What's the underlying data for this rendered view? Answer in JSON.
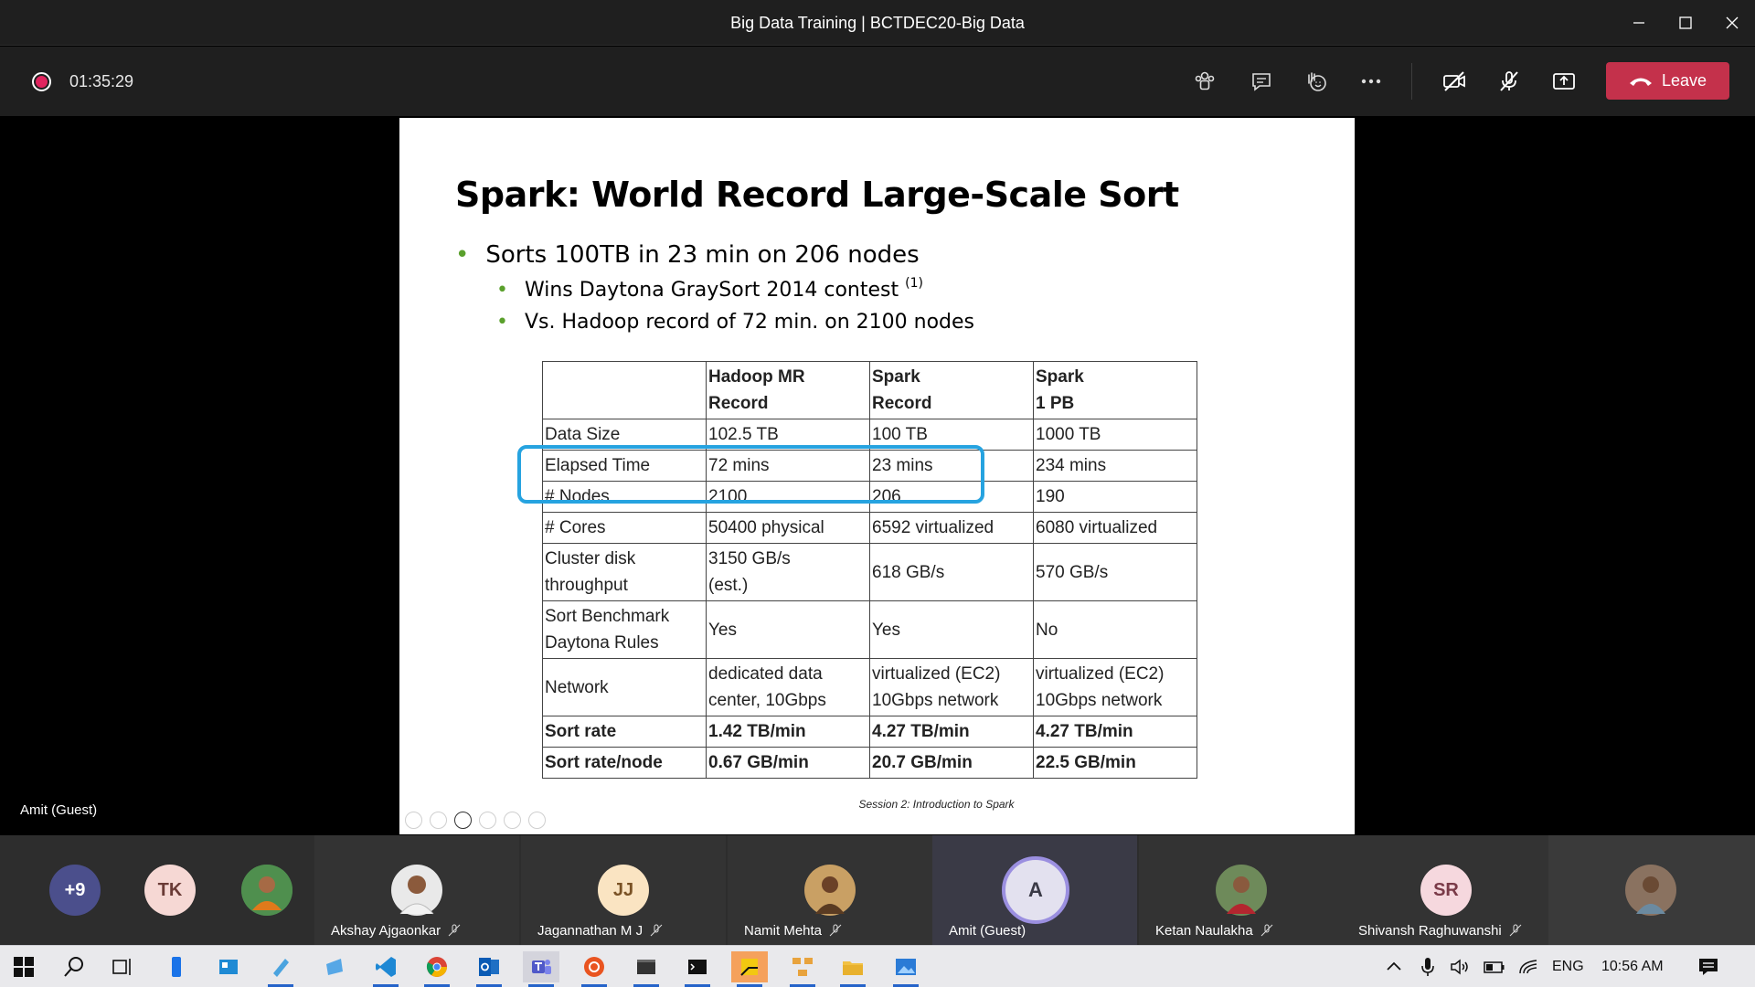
{
  "window": {
    "title": "Big Data Training | BCTDEC20-Big Data"
  },
  "toolbar": {
    "timer": "01:35:29",
    "leave_label": "Leave",
    "leave_color": "#c4314b"
  },
  "slide": {
    "title": "Spark: World Record Large-Scale Sort",
    "bullets": {
      "main": "Sorts 100TB in 23 min on 206 nodes",
      "sub1": "Wins Daytona GraySort 2014 contest",
      "sub1_ref": "(1)",
      "sub2": "Vs. Hadoop record of 72 min. on 2100 nodes"
    },
    "table": {
      "headers": [
        {
          "line1": "",
          "line2": ""
        },
        {
          "line1": "Hadoop MR",
          "line2": "Record"
        },
        {
          "line1": "Spark",
          "line2": "Record"
        },
        {
          "line1": "Spark",
          "line2": "1 PB"
        }
      ],
      "rows": [
        {
          "label": [
            "Data Size"
          ],
          "values": [
            [
              "102.5 TB"
            ],
            [
              "100 TB"
            ],
            [
              "1000 TB"
            ]
          ]
        },
        {
          "label": [
            "Elapsed Time"
          ],
          "values": [
            [
              "72 mins"
            ],
            [
              "23 mins"
            ],
            [
              "234 mins"
            ]
          ]
        },
        {
          "label": [
            "# Nodes"
          ],
          "values": [
            [
              "2100"
            ],
            [
              "206"
            ],
            [
              "190"
            ]
          ]
        },
        {
          "label": [
            "# Cores"
          ],
          "values": [
            [
              "50400 physical"
            ],
            [
              "6592 virtualized"
            ],
            [
              "6080 virtualized"
            ]
          ]
        },
        {
          "label": [
            "Cluster disk",
            "throughput"
          ],
          "values": [
            [
              "3150 GB/s",
              "(est.)"
            ],
            [
              "618 GB/s"
            ],
            [
              "570 GB/s"
            ]
          ]
        },
        {
          "label": [
            "Sort Benchmark",
            "Daytona Rules"
          ],
          "values": [
            [
              "Yes"
            ],
            [
              "Yes"
            ],
            [
              "No"
            ]
          ]
        },
        {
          "label": [
            "Network"
          ],
          "values": [
            [
              "dedicated data",
              "center, 10Gbps"
            ],
            [
              "virtualized (EC2)",
              "10Gbps network"
            ],
            [
              "virtualized (EC2)",
              "10Gbps network"
            ]
          ]
        },
        {
          "label": [
            "Sort rate"
          ],
          "bold": true,
          "values": [
            [
              "1.42 TB/min"
            ],
            [
              "4.27 TB/min"
            ],
            [
              "4.27 TB/min"
            ]
          ]
        },
        {
          "label": [
            "Sort rate/node"
          ],
          "bold": true,
          "values": [
            [
              "0.67 GB/min"
            ],
            [
              "20.7 GB/min"
            ],
            [
              "22.5 GB/min"
            ]
          ]
        }
      ]
    },
    "footer": "Session 2: Introduction to Spark",
    "highlight_color": "#26a3e0"
  },
  "stage": {
    "speaker_label": "Amit (Guest)"
  },
  "participants": {
    "overflow": "+9",
    "tk_initials": "TK",
    "named": [
      {
        "name": "Akshay Ajgaonkar",
        "muted": true
      },
      {
        "name": "Jagannathan M J",
        "initials": "JJ",
        "muted": true
      },
      {
        "name": "Namit Mehta",
        "muted": true
      },
      {
        "name": "Amit (Guest)",
        "initials": "A",
        "muted": false
      },
      {
        "name": "Ketan Naulakha",
        "muted": true
      },
      {
        "name": "Shivansh Raghuwanshi",
        "initials": "SR",
        "muted": true
      }
    ]
  },
  "taskbar": {
    "language": "ENG",
    "time": "10:56 AM"
  }
}
